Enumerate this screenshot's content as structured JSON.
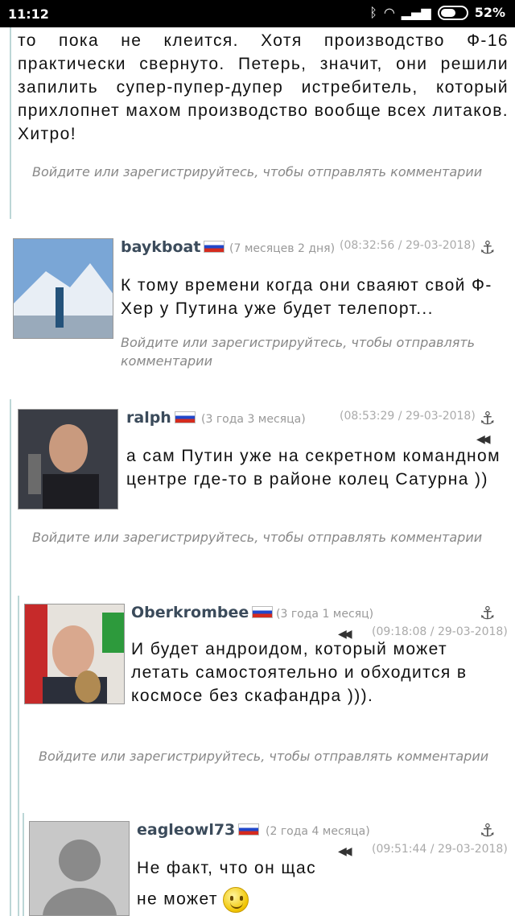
{
  "status": {
    "time": "11:12",
    "battery_pct": "52%"
  },
  "post_text": "то пока не клеится. Хотя производство Ф-16 практически свернуто. Петерь, значит, они решили запилить супер-пупер-дупер истребитель, который прихлопнет махом производство вообще всех литаков. Хитро!",
  "login_note": "Войдите или зарегистрируйтесь, чтобы отправлять комментарии",
  "comments": [
    {
      "author": "baykboat",
      "age": "(7 месяцев 2 дня)",
      "timestamp": "(08:32:56 / 29-03-2018)",
      "text": "К тому времени когда они сваяют свой Ф-Хер у Путина уже будет телепорт..."
    },
    {
      "author": "ralph",
      "age": "(3 года 3 месяца)",
      "timestamp": "(08:53:29 / 29-03-2018)",
      "text": "а сам Путин уже на секретном командном центре где-то в районе колец Сатурна ))"
    },
    {
      "author": "Oberkrombee",
      "age": "(3 года 1 месяц)",
      "timestamp": "(09:18:08 / 29-03-2018)",
      "text": "И будет андроидом, который может летать самостоятельно и обходится в космосе без скафандра )))."
    },
    {
      "author": "eagleowl73",
      "age": "(2 года 4 месяца)",
      "timestamp": "(09:51:44 / 29-03-2018)",
      "text_line1": "Не факт, что он щас",
      "text_line2": "не может"
    }
  ],
  "icons": {
    "anchor": "anchor-icon",
    "reply": "reply-arrow-icon",
    "flag": "russia-flag-icon",
    "smiley": "smiley-icon"
  },
  "colors": {
    "author": "#3b4b5b",
    "muted": "#888888",
    "thread_line": "#bcd6d6"
  }
}
